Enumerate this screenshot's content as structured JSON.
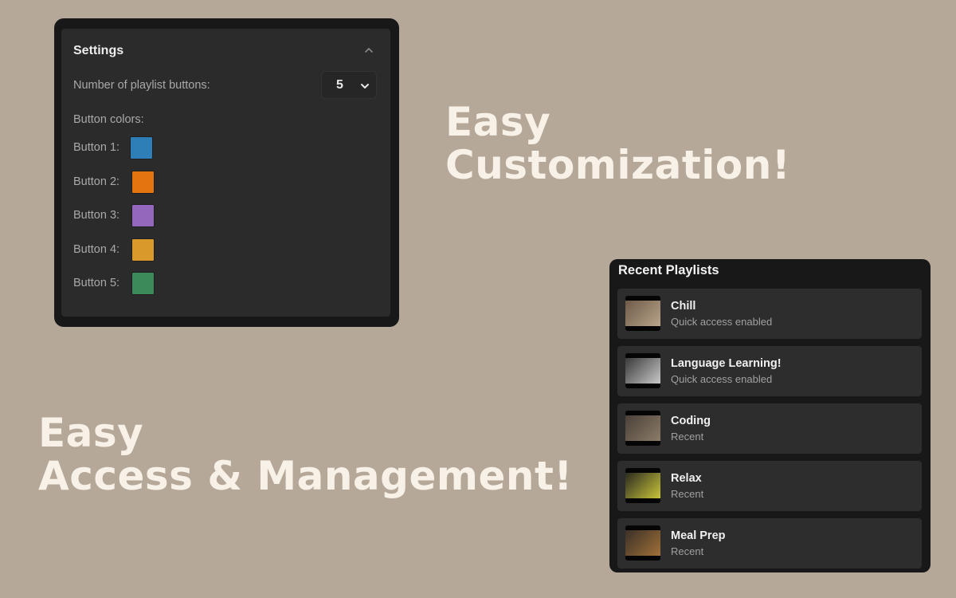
{
  "settings": {
    "title": "Settings",
    "playlist_buttons_label": "Number of playlist buttons:",
    "playlist_buttons_value": "5",
    "button_colors_label": "Button colors:",
    "buttons": [
      {
        "label": "Button 1:",
        "color": "#2e7fb8"
      },
      {
        "label": "Button 2:",
        "color": "#e3740f"
      },
      {
        "label": "Button 3:",
        "color": "#9467bd"
      },
      {
        "label": "Button 4:",
        "color": "#d99a2b"
      },
      {
        "label": "Button 5:",
        "color": "#3c8a5a"
      }
    ]
  },
  "headlines": {
    "top_line1": "Easy",
    "top_line2": "Customization!",
    "bottom_line1": "Easy",
    "bottom_line2": "Access & Management!"
  },
  "recent_playlists": {
    "title": "Recent Playlists",
    "items": [
      {
        "name": "Chill",
        "status": "Quick access enabled",
        "thumb_colors": [
          "#6e5a48",
          "#b8a58a"
        ]
      },
      {
        "name": "Language Learning!",
        "status": "Quick access enabled",
        "thumb_colors": [
          "#3a3a3a",
          "#c8c8c8"
        ]
      },
      {
        "name": "Coding",
        "status": "Recent",
        "thumb_colors": [
          "#4a4038",
          "#8c7c68"
        ]
      },
      {
        "name": "Relax",
        "status": "Recent",
        "thumb_colors": [
          "#2b2b20",
          "#c9c43a"
        ]
      },
      {
        "name": "Meal Prep",
        "status": "Recent",
        "thumb_colors": [
          "#3b3028",
          "#a07038"
        ]
      }
    ]
  }
}
